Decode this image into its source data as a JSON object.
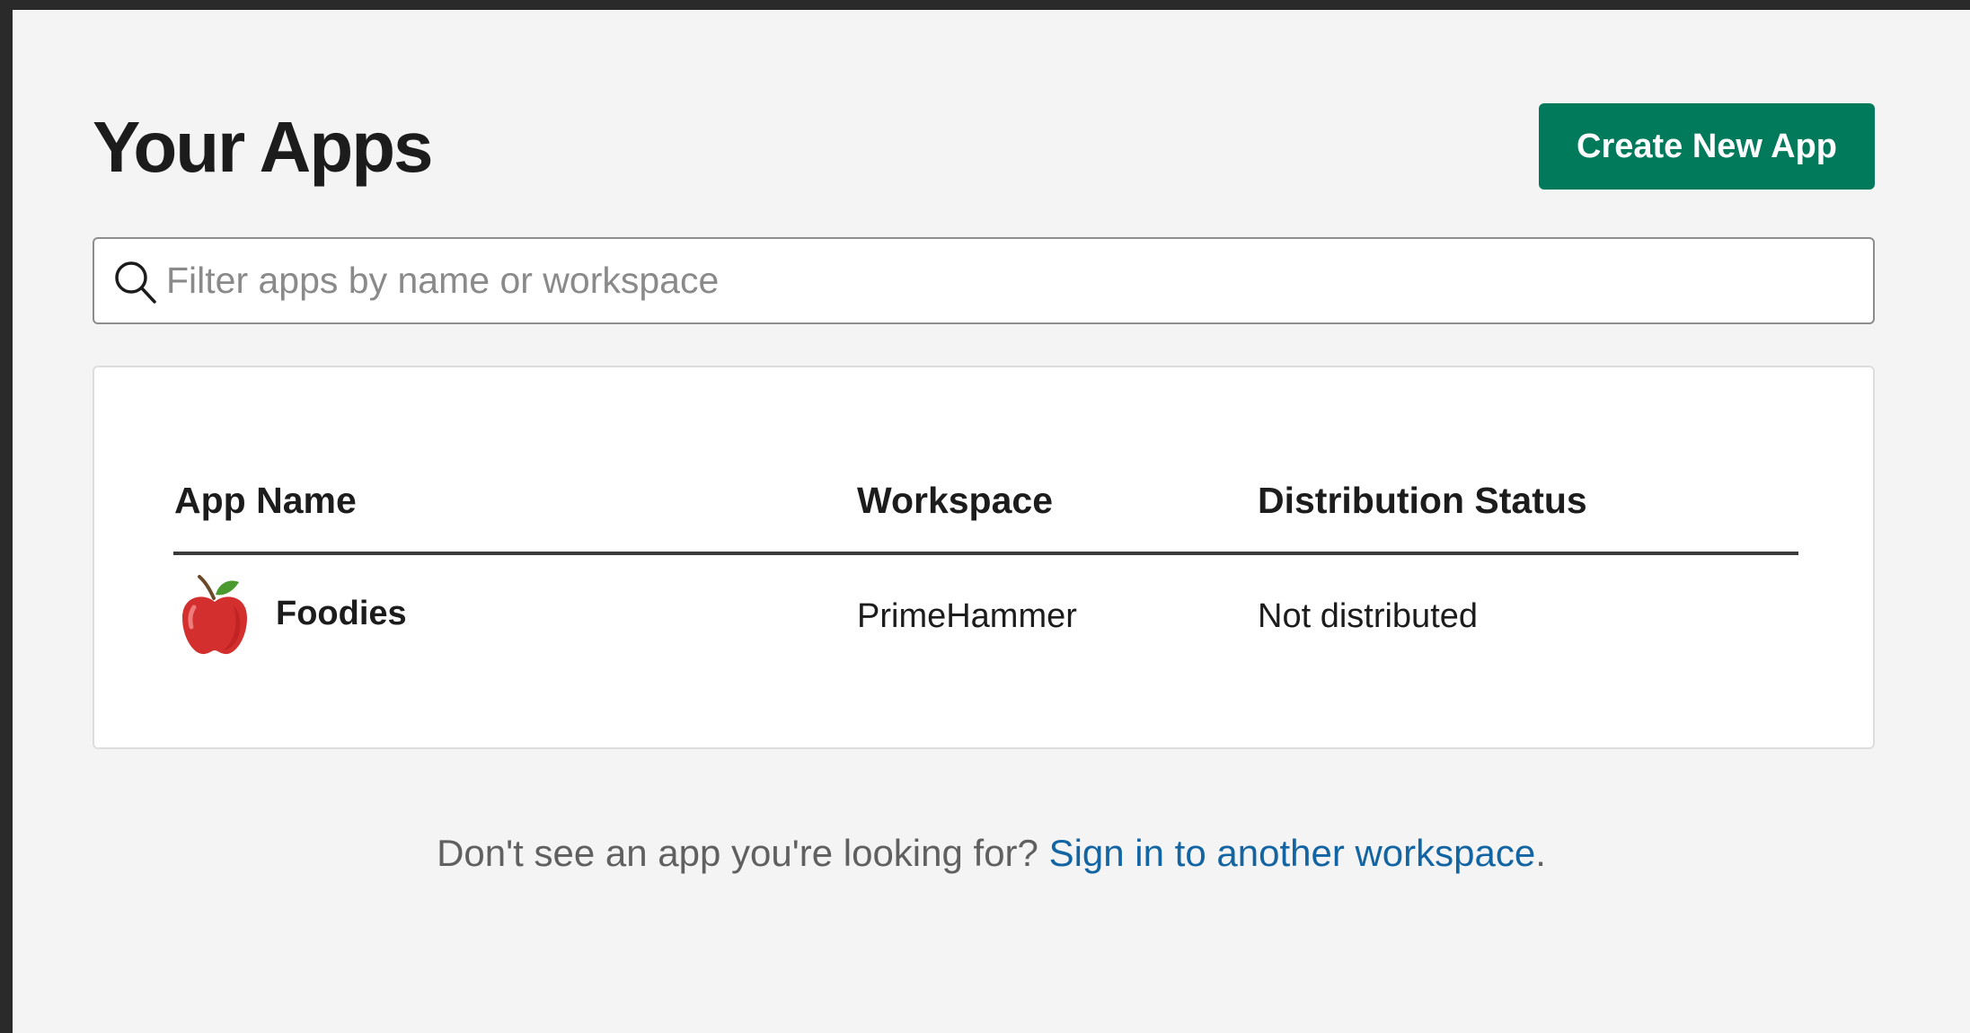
{
  "page": {
    "title": "Your Apps"
  },
  "toolbar": {
    "create_label": "Create New App"
  },
  "search": {
    "icon": "search-icon",
    "value": "",
    "placeholder": "Filter apps by name or workspace"
  },
  "table": {
    "columns": [
      "App Name",
      "Workspace",
      "Distribution Status"
    ],
    "rows": [
      {
        "icon": "apple-icon",
        "name": "Foodies",
        "workspace": "PrimeHammer",
        "status": "Not distributed"
      }
    ]
  },
  "footer": {
    "prompt": "Don't see an app you're looking for? ",
    "link": "Sign in to another workspace",
    "suffix": "."
  },
  "colors": {
    "accent": "#007a5a",
    "link": "#1264a3",
    "background": "#f4f4f4",
    "frame": "#2a2a2a"
  }
}
